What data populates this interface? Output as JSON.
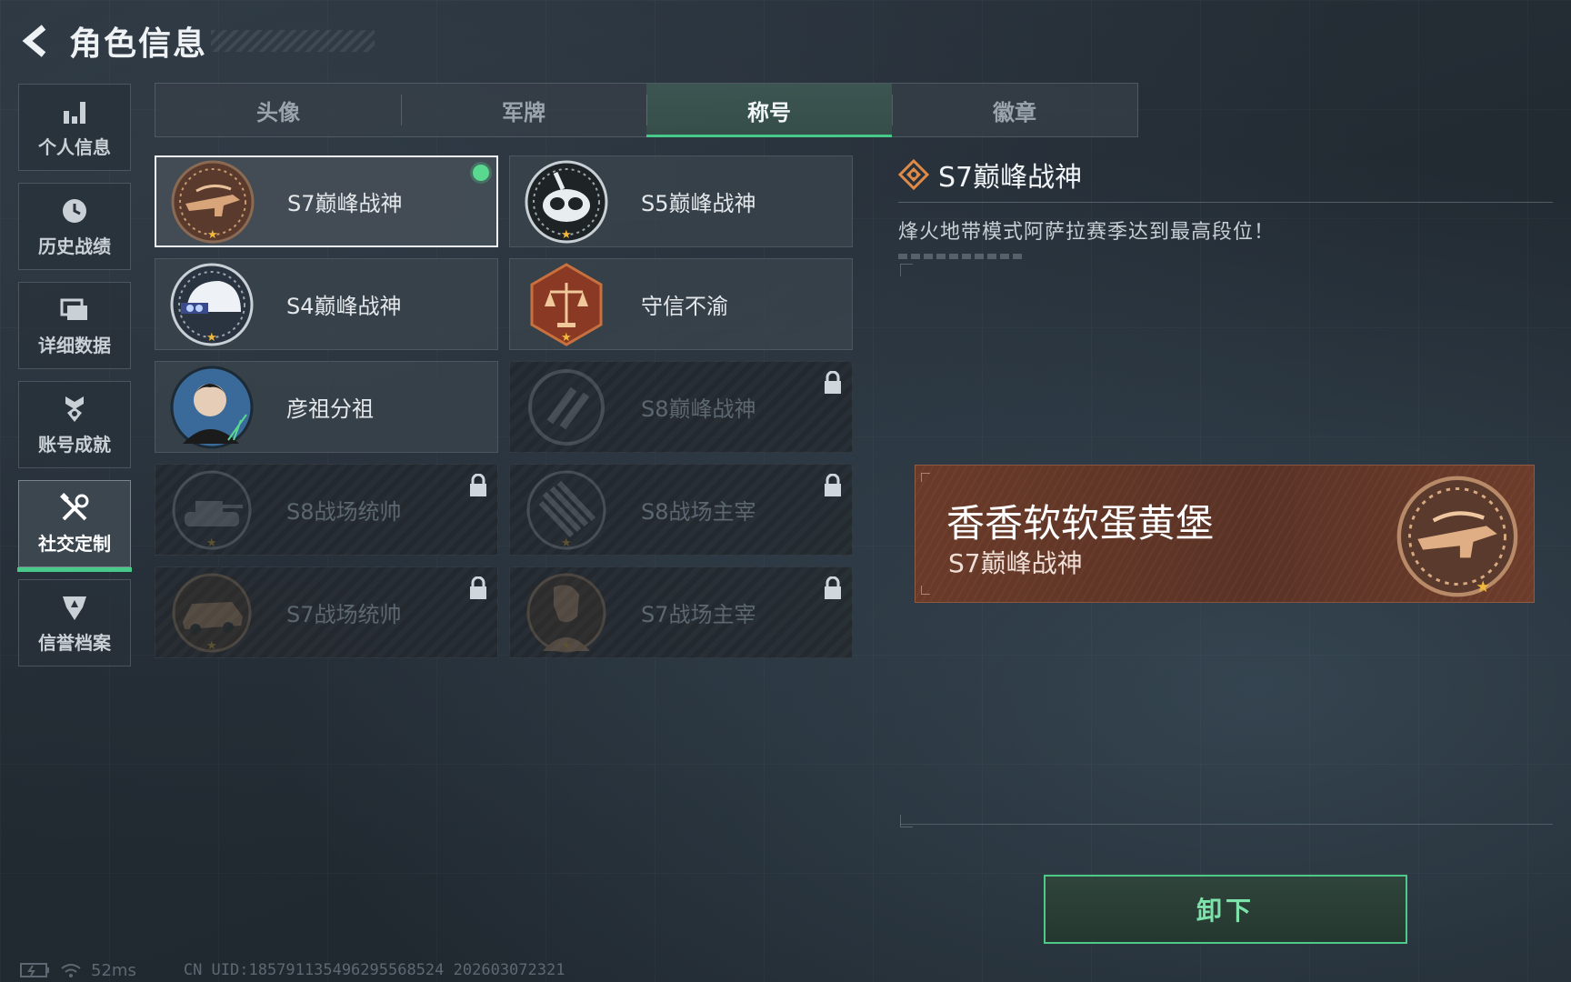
{
  "header": {
    "title": "角色信息"
  },
  "sidebar": {
    "items": [
      {
        "label": "个人信息",
        "icon": "bar-chart-icon",
        "active": false
      },
      {
        "label": "历史战绩",
        "icon": "history-icon",
        "active": false
      },
      {
        "label": "详细数据",
        "icon": "folder-icon",
        "active": false
      },
      {
        "label": "账号成就",
        "icon": "achievement-icon",
        "active": false
      },
      {
        "label": "社交定制",
        "icon": "tools-icon",
        "active": true
      },
      {
        "label": "信誉档案",
        "icon": "reputation-icon",
        "active": false
      }
    ]
  },
  "tabs": [
    {
      "label": "头像",
      "active": false
    },
    {
      "label": "军牌",
      "active": false
    },
    {
      "label": "称号",
      "active": true
    },
    {
      "label": "徽章",
      "active": false
    }
  ],
  "titles": [
    {
      "name": "S7巅峰战神",
      "icon": "rifle-badge-icon",
      "locked": false,
      "selected": true
    },
    {
      "name": "S5巅峰战神",
      "icon": "skull-mask-badge-icon",
      "locked": false,
      "selected": false
    },
    {
      "name": "S4巅峰战神",
      "icon": "helmet-badge-icon",
      "locked": false,
      "selected": false
    },
    {
      "name": "守信不渝",
      "icon": "scales-badge-icon",
      "locked": false,
      "selected": false
    },
    {
      "name": "彦祖分祖",
      "icon": "portrait-badge-icon",
      "locked": false,
      "selected": false
    },
    {
      "name": "S8巅峰战神",
      "icon": "slash-badge-icon",
      "locked": true,
      "selected": false
    },
    {
      "name": "S8战场统帅",
      "icon": "tank-badge-icon",
      "locked": true,
      "selected": false
    },
    {
      "name": "S8战场主宰",
      "icon": "ammo-badge-icon",
      "locked": true,
      "selected": false
    },
    {
      "name": "S7战场统帅",
      "icon": "vehicle-badge-icon",
      "locked": true,
      "selected": false
    },
    {
      "name": "S7战场主宰",
      "icon": "soldier-badge-icon",
      "locked": true,
      "selected": false
    }
  ],
  "detail": {
    "title": "S7巅峰战神",
    "description": "烽火地带模式阿萨拉赛季达到最高段位！"
  },
  "nameplate": {
    "player_name": "香香软软蛋黄堡",
    "title": "S7巅峰战神"
  },
  "action": {
    "unequip_label": "卸下"
  },
  "status": {
    "ping": "52ms",
    "uid": "CN UID:185791135496295568524 202603072321"
  },
  "colors": {
    "accent": "#47c98a",
    "equipped": "#58d98f",
    "nameplate_bg": "#6a3a28",
    "star": "#f0b93c"
  }
}
